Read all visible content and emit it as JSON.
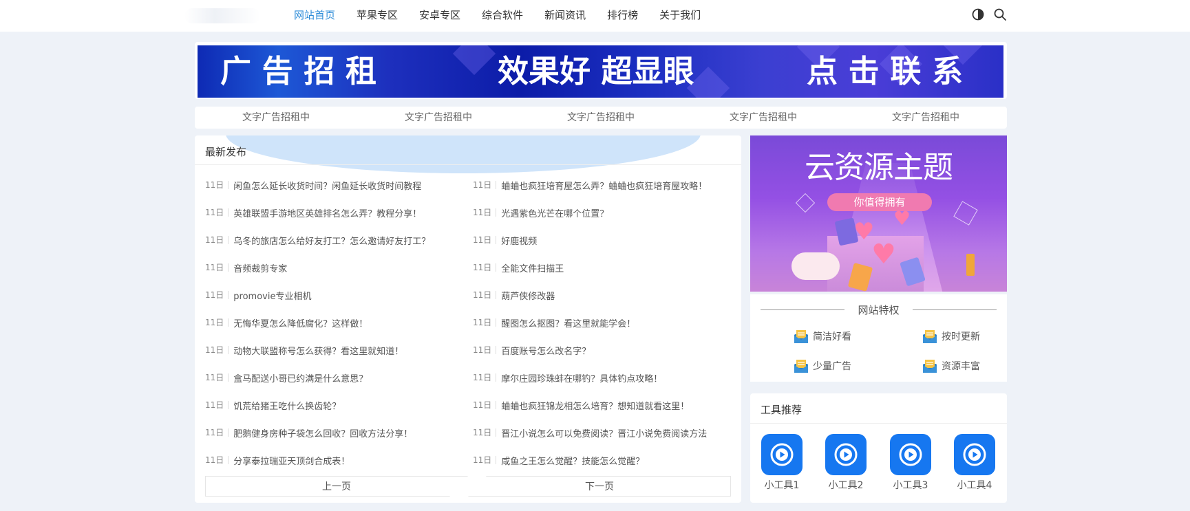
{
  "nav": {
    "items": [
      "网站首页",
      "苹果专区",
      "安卓专区",
      "综合软件",
      "新闻资讯",
      "排行榜",
      "关于我们"
    ],
    "active_index": 0
  },
  "header_icons": [
    "theme-toggle-icon",
    "search-icon"
  ],
  "banner": {
    "left": "广 告 招 租",
    "middle": "效果好 超显眼",
    "right": "点 击 联 系"
  },
  "text_ads": [
    "文字广告招租中",
    "文字广告招租中",
    "文字广告招租中",
    "文字广告招租中",
    "文字广告招租中"
  ],
  "latest": {
    "title": "最新发布",
    "left": [
      {
        "date": "11日",
        "title": "闲鱼怎么延长收货时间？闲鱼延长收货时间教程"
      },
      {
        "date": "11日",
        "title": "英雄联盟手游地区英雄排名怎么弄？教程分享！"
      },
      {
        "date": "11日",
        "title": "乌冬的旅店怎么给好友打工？怎么邀请好友打工？"
      },
      {
        "date": "11日",
        "title": "音频裁剪专家"
      },
      {
        "date": "11日",
        "title": "promovie专业相机"
      },
      {
        "date": "11日",
        "title": "无悔华夏怎么降低腐化？这样做！"
      },
      {
        "date": "11日",
        "title": "动物大联盟称号怎么获得？看这里就知道！"
      },
      {
        "date": "11日",
        "title": "盒马配送小哥已约满是什么意思？"
      },
      {
        "date": "11日",
        "title": "饥荒给猪王吃什么换齿轮？"
      },
      {
        "date": "11日",
        "title": "肥鹅健身房种子袋怎么回收？回收方法分享！"
      },
      {
        "date": "11日",
        "title": "分享泰拉瑞亚天顶剑合成表！"
      }
    ],
    "right": [
      {
        "date": "11日",
        "title": "蛐蛐也疯狂培育屋怎么弄？蛐蛐也疯狂培育屋攻略！"
      },
      {
        "date": "11日",
        "title": "光遇紫色光芒在哪个位置？"
      },
      {
        "date": "11日",
        "title": "好鹿视频"
      },
      {
        "date": "11日",
        "title": "全能文件扫描王"
      },
      {
        "date": "11日",
        "title": "葫芦侠修改器"
      },
      {
        "date": "11日",
        "title": "醒图怎么抠图？看这里就能学会！"
      },
      {
        "date": "11日",
        "title": "百度账号怎么改名字？"
      },
      {
        "date": "11日",
        "title": "摩尔庄园珍珠蚌在哪钓？具体钓点攻略！"
      },
      {
        "date": "11日",
        "title": "蛐蛐也疯狂锦龙相怎么培育？想知道就看这里！"
      },
      {
        "date": "11日",
        "title": "晋江小说怎么可以免费阅读？晋江小说免费阅读方法"
      },
      {
        "date": "11日",
        "title": "咸鱼之王怎么觉醒？技能怎么觉醒？"
      }
    ],
    "prev_label": "上一页",
    "next_label": "下一页"
  },
  "promo": {
    "title": "云资源主题",
    "subtitle": "你值得拥有"
  },
  "privilege": {
    "title": "网站特权",
    "items": [
      "简洁好看",
      "按时更新",
      "少量广告",
      "资源丰富"
    ],
    "icon": "envelope-icon"
  },
  "tools": {
    "title": "工具推荐",
    "items": [
      "小工具1",
      "小工具2",
      "小工具3",
      "小工具4"
    ],
    "icon": "play-circle-icon",
    "color": "#1677f0"
  },
  "colors": {
    "accent": "#2d8cd8",
    "page_bg": "#eef2f8"
  }
}
